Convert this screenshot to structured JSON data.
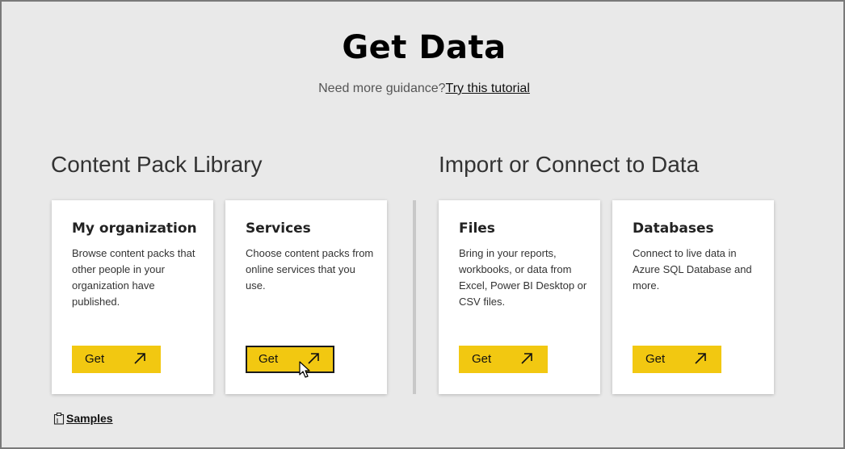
{
  "header": {
    "title": "Get Data",
    "guidance_text": "Need more guidance?",
    "tutorial_link": "Try this tutorial"
  },
  "sections": [
    {
      "title": "Content Pack Library",
      "cards": [
        {
          "title": "My organization",
          "description": "Browse content packs that other people in your organization have published.",
          "button": "Get"
        },
        {
          "title": "Services",
          "description": "Choose content packs from online services that you use.",
          "button": "Get"
        }
      ]
    },
    {
      "title": "Import or Connect to Data",
      "cards": [
        {
          "title": "Files",
          "description": "Bring in your reports, workbooks, or data from Excel, Power BI Desktop or CSV files.",
          "button": "Get"
        },
        {
          "title": "Databases",
          "description": "Connect to live data in Azure SQL Database and more.",
          "button": "Get"
        }
      ]
    }
  ],
  "footer": {
    "samples_link": "Samples",
    "samples_icon": "clipboard-icon"
  },
  "colors": {
    "accent": "#f2c811",
    "background": "#e9e9e9",
    "card": "#ffffff"
  },
  "icons": {
    "button_arrow": "arrow-up-right-icon",
    "cursor": "mouse-pointer-icon"
  }
}
